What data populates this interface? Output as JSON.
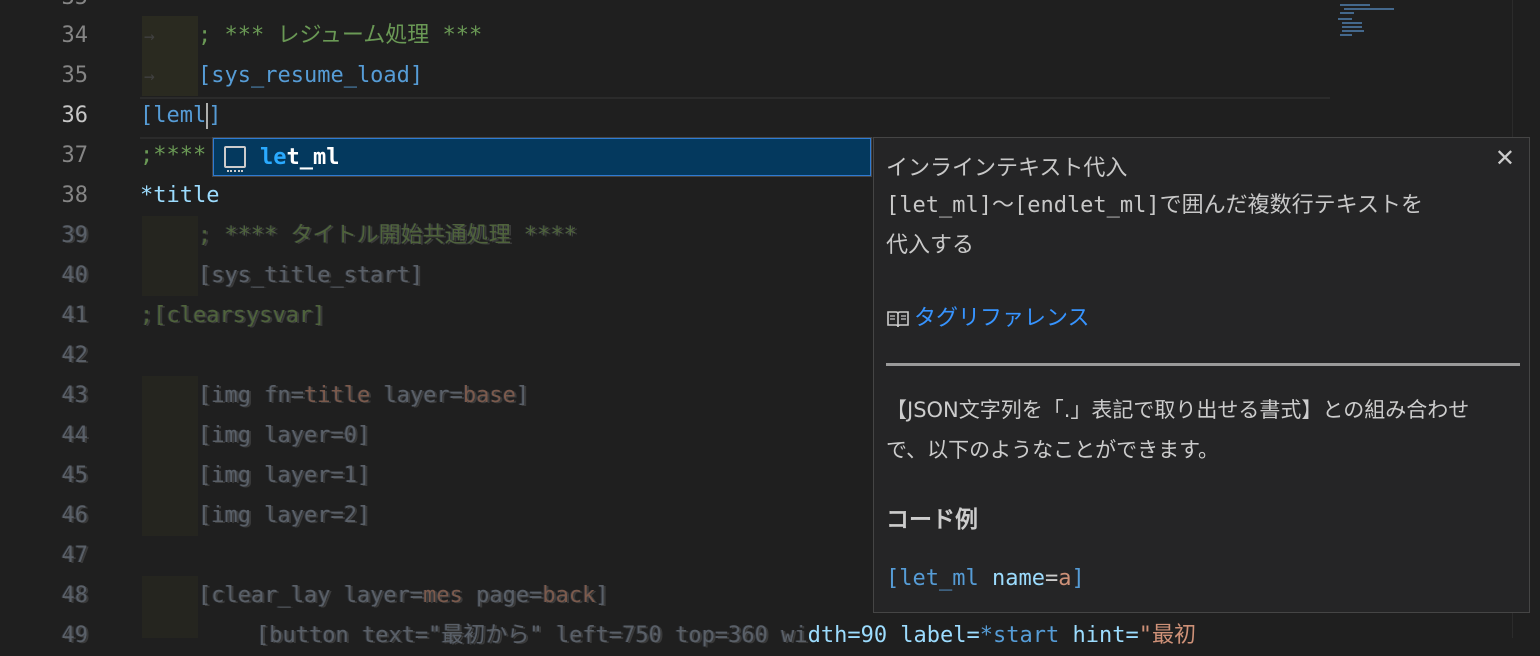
{
  "colors": {
    "background": "#1f1f1f",
    "comment": "#6a9955",
    "tag": "#569cd6",
    "selection": "#04395e",
    "link": "#3794ff"
  },
  "gutter": {
    "line_top": "35",
    "lines": [
      "34",
      "35",
      "36",
      "37",
      "38"
    ],
    "ghost_lines": [
      "39",
      "40",
      "41",
      "42",
      "43",
      "44",
      "45",
      "46",
      "47",
      "48",
      "49"
    ]
  },
  "code": {
    "line34": "; *** レジューム処理 ***",
    "line35": "[sys_resume_load]",
    "line36_typed": "[leml",
    "line36_close": "]",
    "line37": ";****",
    "line38": "*title",
    "ghost": {
      "l39": "; **** タイトル開始共通処理 ****",
      "l40": "[sys_title_start]",
      "l41": ";[clearsysvar]",
      "l43a": "[img fn=",
      "l43b": "title",
      "l43c": " layer=",
      "l43d": "base",
      "l43e": "]",
      "l44": "[img layer=0]",
      "l45": "[img layer=1]",
      "l46": "[img layer=2]",
      "l48a": "[clear_lay layer=",
      "l48b": "mes",
      "l48c": " page=",
      "l48d": "back",
      "l48e": "]",
      "l49a": "[button text=\"最初から\" left=750 top=360 wi",
      "l49b": "dth=90 label=",
      "l49c": "*start",
      "l49d": " hint=",
      "l49e": "\"最初"
    }
  },
  "suggest": {
    "item_highlight": "le",
    "item_rest": "t_ml",
    "icon": "snippet-icon"
  },
  "details": {
    "title": "インラインテキスト代入",
    "desc_line1": "[let_ml]〜[endlet_ml]で囲んだ複数行テキストを",
    "desc_line2": "代入する",
    "link_icon": "book-icon",
    "link_label": "タグリファレンス",
    "para_line1": "【JSON文字列を「.」表記で取り出せる書式】との組み合わせ",
    "para_line2": "で、以下のようなことができます。",
    "heading": "コード例",
    "code_tag": "[let_ml",
    "code_attr": "name",
    "code_eq": "=",
    "code_val": "a",
    "code_close": "]",
    "close_icon": "close-icon"
  }
}
